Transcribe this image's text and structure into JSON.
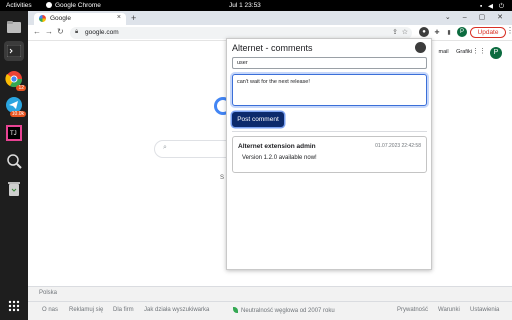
{
  "topbar": {
    "activities": "Activities",
    "app": "Google Chrome",
    "clock": "Jul 1  23:53"
  },
  "dock": {
    "telegram_badge": "10.0k",
    "chrome_badge": "12"
  },
  "chrome": {
    "tab_title": "Google",
    "new_tab": "+",
    "url": "google.com",
    "update_label": "Update",
    "profile_initial": "P"
  },
  "google": {
    "header_links": [
      "mail",
      "Grafiki"
    ],
    "avatar": "P",
    "search_letter": "S",
    "footer": {
      "country": "Polska",
      "left_links": [
        "O nas",
        "Reklamuj się",
        "Dla firm",
        "Jak działa wyszukiwarka"
      ],
      "carbon": "Neutralność węglowa od 2007 roku",
      "right_links": [
        "Prywatność",
        "Warunki",
        "Ustawienia"
      ]
    }
  },
  "popup": {
    "title": "Alternet - comments",
    "user_value": "user",
    "comment_value": "can't wait for the next release!",
    "post_label": "Post comment",
    "comments": [
      {
        "author": "Alternet extension admin",
        "date": "01.07.2023 22:42:58",
        "text": "Version 1.2.0 available now!"
      }
    ]
  },
  "colors": {
    "accent": "#0c2a6c",
    "focus": "#3b6fd8",
    "update": "#d93025"
  }
}
